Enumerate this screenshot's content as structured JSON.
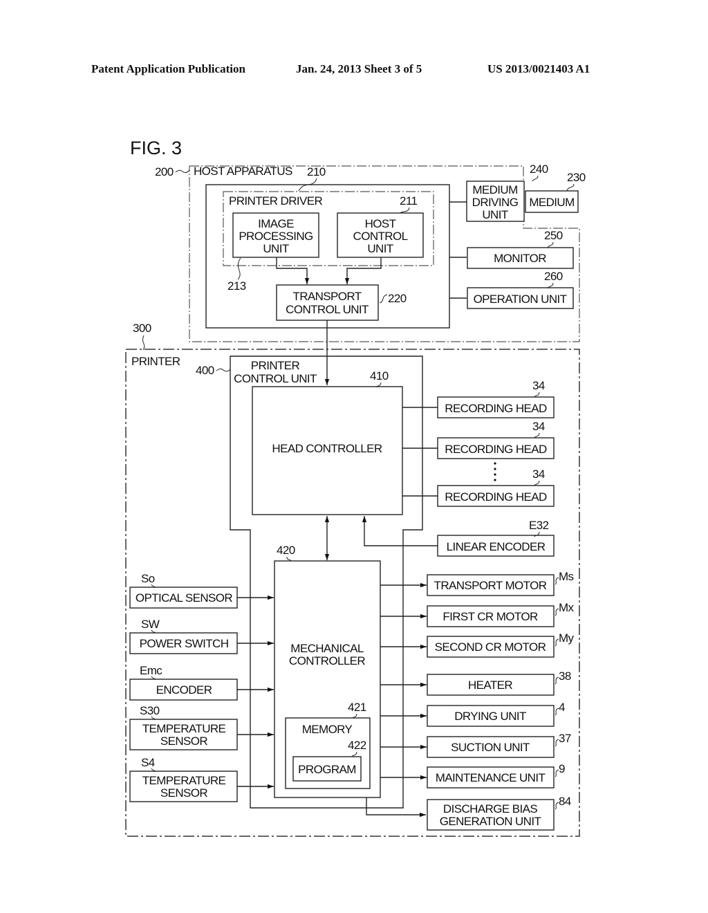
{
  "header": {
    "left": "Patent Application Publication",
    "middle": "Jan. 24, 2013   Sheet 3 of 5",
    "right": "US 2013/0021403 A1"
  },
  "figure": {
    "title": "FIG. 3",
    "host": {
      "ref": "200",
      "label": "HOST APPARATUS",
      "driver_block_ref": "210",
      "printer_driver": {
        "label": "PRINTER DRIVER",
        "ref": "211"
      },
      "image_processing": {
        "lines": [
          "IMAGE",
          "PROCESSING",
          "UNIT"
        ],
        "ref": "213"
      },
      "host_control": {
        "lines": [
          "HOST",
          "CONTROL",
          "UNIT"
        ]
      },
      "transport_control": {
        "lines": [
          "TRANSPORT",
          "CONTROL UNIT"
        ],
        "ref": "220"
      },
      "medium_driving": {
        "lines": [
          "MEDIUM",
          "DRIVING",
          "UNIT"
        ],
        "ref": "240"
      },
      "medium": {
        "label": "MEDIUM",
        "ref": "230"
      },
      "monitor": {
        "label": "MONITOR",
        "ref": "250"
      },
      "operation_unit": {
        "label": "OPERATION UNIT",
        "ref": "260"
      }
    },
    "printer": {
      "ref": "300",
      "label": "PRINTER",
      "control_unit": {
        "lines": [
          "PRINTER",
          "CONTROL UNIT"
        ],
        "ref": "400"
      },
      "head_controller": {
        "label": "HEAD CONTROLLER",
        "ref": "410"
      },
      "mechanical_controller": {
        "lines": [
          "MECHANICAL",
          "CONTROLLER"
        ],
        "ref": "420"
      },
      "memory": {
        "label": "MEMORY",
        "ref": "421"
      },
      "program": {
        "label": "PROGRAM",
        "ref": "422"
      },
      "recording_heads": [
        {
          "label": "RECORDING HEAD",
          "ref": "34"
        },
        {
          "label": "RECORDING HEAD",
          "ref": "34"
        },
        {
          "label": "RECORDING HEAD",
          "ref": "34"
        }
      ],
      "linear_encoder": {
        "label": "LINEAR ENCODER",
        "ref": "E32"
      },
      "inputs": [
        {
          "lines": [
            "OPTICAL SENSOR"
          ],
          "ref": "So"
        },
        {
          "lines": [
            "POWER SWITCH"
          ],
          "ref": "SW"
        },
        {
          "lines": [
            "ENCODER"
          ],
          "ref": "Emc"
        },
        {
          "lines": [
            "TEMPERATURE",
            "SENSOR"
          ],
          "ref": "S30"
        },
        {
          "lines": [
            "TEMPERATURE",
            "SENSOR"
          ],
          "ref": "S4"
        }
      ],
      "outputs": [
        {
          "lines": [
            "TRANSPORT MOTOR"
          ],
          "ref": "Ms"
        },
        {
          "lines": [
            "FIRST CR MOTOR"
          ],
          "ref": "Mx"
        },
        {
          "lines": [
            "SECOND CR MOTOR"
          ],
          "ref": "My"
        },
        {
          "lines": [
            "HEATER"
          ],
          "ref": "38"
        },
        {
          "lines": [
            "DRYING UNIT"
          ],
          "ref": "4"
        },
        {
          "lines": [
            "SUCTION UNIT"
          ],
          "ref": "37"
        },
        {
          "lines": [
            "MAINTENANCE UNIT"
          ],
          "ref": "9"
        },
        {
          "lines": [
            "DISCHARGE BIAS",
            "GENERATION UNIT"
          ],
          "ref": "84"
        }
      ]
    }
  }
}
